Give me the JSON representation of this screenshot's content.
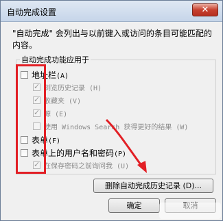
{
  "window": {
    "title": "自动完成设置",
    "close_glyph": "✕"
  },
  "description": "\"自动完成\" 会列出与以前键入或访问的条目可能匹配的内容。",
  "group": {
    "title": "自动完成功能应用于",
    "items": [
      {
        "label": "地址栏",
        "accel": "(A)",
        "checked": false,
        "enabled": true
      },
      {
        "label": "浏览历史记录",
        "accel": "(H)",
        "checked": true,
        "enabled": false
      },
      {
        "label": "收藏夹",
        "accel": "(V)",
        "checked": true,
        "enabled": false
      },
      {
        "label": "源",
        "accel": "(E)",
        "checked": true,
        "enabled": false
      },
      {
        "label": "使用 Windows Search 获得更好的结果",
        "accel": "(W)",
        "checked": false,
        "enabled": false
      },
      {
        "label": "表单",
        "accel": "(F)",
        "checked": false,
        "enabled": true
      },
      {
        "label": "表单上的用户名和密码",
        "accel": "(P)",
        "checked": false,
        "enabled": true
      },
      {
        "label": "在保存密码之前询问我",
        "accel": "(U)",
        "checked": true,
        "enabled": false
      }
    ]
  },
  "buttons": {
    "delete_history": "删除自动完成历史记录 (D)...",
    "ok": "确定",
    "cancel": "取消"
  },
  "colors": {
    "annotation": "#e21f25"
  }
}
